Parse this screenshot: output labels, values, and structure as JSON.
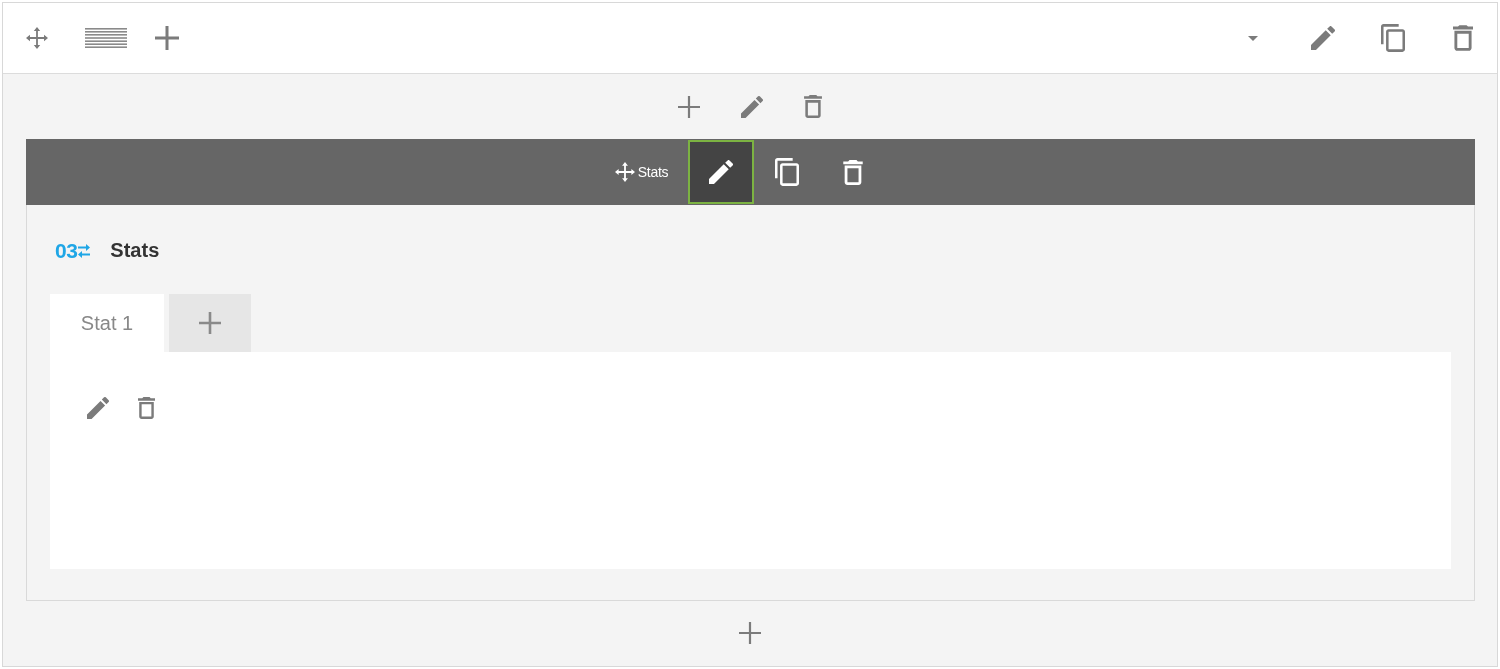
{
  "module_bar": {
    "label": "Stats",
    "actions": [
      {
        "kind": "edit",
        "selected": true
      },
      {
        "kind": "copy",
        "selected": false
      },
      {
        "kind": "delete",
        "selected": false
      }
    ]
  },
  "module": {
    "badge": "03",
    "title": "Stats"
  },
  "tabs": [
    {
      "label": "Stat 1",
      "selected": true
    }
  ]
}
